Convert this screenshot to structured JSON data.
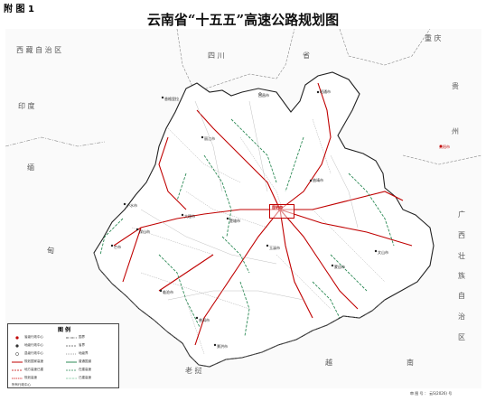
{
  "attachment_label": "附 图 1",
  "title": "云南省“十五五”高速公路规划图",
  "regions": {
    "tibet": "西 藏 自 治 区",
    "sichuan_upper": "四 川",
    "sichuan_right": "省",
    "chongqing": "重 庆",
    "guizhou_1": "贵",
    "guizhou_2": "州",
    "india": "印 度",
    "myanmar_1": "缅",
    "myanmar_2": "甸",
    "guangxi_1": "广",
    "guangxi_2": "西",
    "guangxi_3": "壮",
    "guangxi_4": "族",
    "guangxi_5": "自",
    "guangxi_6": "治",
    "guangxi_7": "区",
    "laos": "老 挝",
    "vietnam": "越",
    "vietnam_2": "南",
    "guizhou_city": "贵阳市",
    "sichuan_city": "西昌市"
  },
  "cities": {
    "kunming": "昆明市",
    "zhaotong": "昭通市",
    "qujing": "曲靖市",
    "lijiang": "丽江市",
    "dali": "大理市",
    "baoshan": "保山市",
    "lincang": "临沧市",
    "puer": "普洱市",
    "jinghong": "景洪市",
    "yuxi": "玉溪市",
    "mengzi": "蒙自市",
    "wenshan": "文山市",
    "chuxiong": "楚雄市",
    "shangri_la": "香格里拉",
    "mangshi": "芒市",
    "lushui": "泸水市"
  },
  "legend": {
    "title": "图    例",
    "items": [
      {
        "label": "省级行政中心",
        "color": "#c00000",
        "kind": "dot"
      },
      {
        "label": "地级行政中心",
        "color": "#333333",
        "kind": "dot"
      },
      {
        "label": "县级行政中心",
        "color": "#333333",
        "kind": "ring"
      },
      {
        "label": "规划国家高速",
        "color": "#c00000",
        "kind": "line"
      },
      {
        "label": "地方高速已建",
        "color": "#c00000",
        "kind": "dash"
      },
      {
        "label": "规划高速",
        "color": "#d00000",
        "kind": "dot-line"
      },
      {
        "label": "国界",
        "color": "#333333",
        "kind": "dash-dot"
      },
      {
        "label": "省界",
        "color": "#555555",
        "kind": "dash"
      },
      {
        "label": "地级界",
        "color": "#888888",
        "kind": "thin-dash"
      },
      {
        "label": "普通国道",
        "color": "#2e8b57",
        "kind": "line"
      },
      {
        "label": "在建高速",
        "color": "#2e8b57",
        "kind": "dash"
      },
      {
        "label": "已建高速",
        "color": "#1f9d55",
        "kind": "dotted"
      }
    ],
    "note": "所有行政中心"
  },
  "footer": "审 图 号 ：  云S(2026)  号",
  "map_colors": {
    "yunnan_fill": "#ffffff",
    "outside_fill": "#f4f4f4",
    "national_expressway": "#c00000",
    "planned": "#2e8b57",
    "border": "#333333"
  }
}
